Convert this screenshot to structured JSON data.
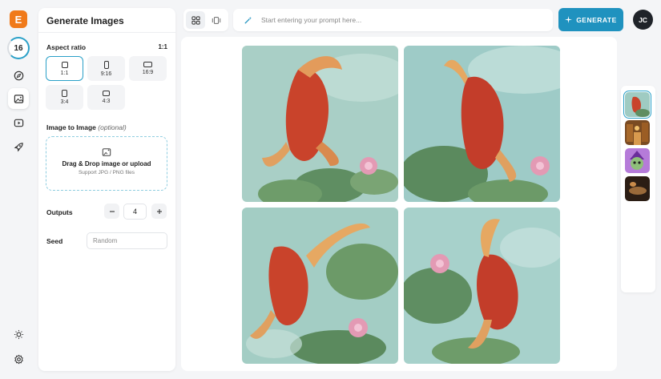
{
  "rail": {
    "logo_letter": "E",
    "credits": "16",
    "items": [
      "compass-icon",
      "image-icon",
      "video-icon",
      "rocket-icon"
    ],
    "bottom": [
      "sun-icon",
      "gear-icon"
    ]
  },
  "panel": {
    "title": "Generate Images",
    "aspect_label": "Aspect ratio",
    "aspect_value": "1:1",
    "ratios": [
      "1:1",
      "9:16",
      "16:9",
      "3:4",
      "4:3"
    ],
    "selected_ratio": "1:1",
    "i2i_label": "Image to Image",
    "i2i_optional": "(optional)",
    "drop_title": "Drag & Drop image or upload",
    "drop_sub": "Support JPG / PNG files",
    "outputs_label": "Outputs",
    "outputs_value": "4",
    "seed_label": "Seed",
    "seed_placeholder": "Random"
  },
  "topbar": {
    "prompt_placeholder": "Start entering your prompt here...",
    "generate_label": "GENERATE",
    "avatar_initials": "JC"
  },
  "colors": {
    "accent": "#1f92bf",
    "selection": "#2aa0c8",
    "logo": "#f07a1a"
  },
  "gallery": {
    "images": [
      "koi-fish-image-1",
      "koi-fish-image-2",
      "koi-fish-image-3",
      "koi-fish-image-4"
    ]
  },
  "history": {
    "thumbs": [
      "koi-thumb",
      "city-street-thumb",
      "purple-creature-thumb",
      "dark-scene-thumb"
    ]
  }
}
